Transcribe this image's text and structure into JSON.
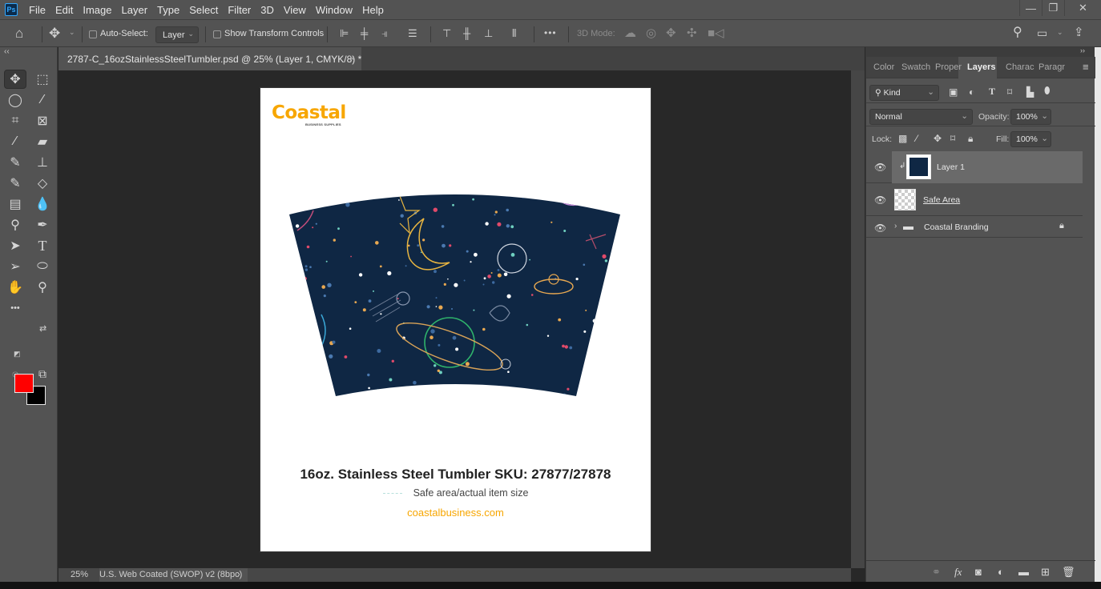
{
  "app": {
    "logo_text": "Ps"
  },
  "menu": [
    "File",
    "Edit",
    "Image",
    "Layer",
    "Type",
    "Select",
    "Filter",
    "3D",
    "View",
    "Window",
    "Help"
  ],
  "window_controls": {
    "minimize": "—",
    "restore": "❐",
    "close": "✕"
  },
  "options_bar": {
    "auto_select_label": "Auto-Select:",
    "auto_select_checked": false,
    "auto_select_target": "Layer",
    "show_transform_label": "Show Transform Controls",
    "show_transform_checked": false,
    "more_label": "•••",
    "three_d_mode_label": "3D Mode:"
  },
  "document": {
    "tab_title": "2787-C_16ozStainlessSteelTumbler.psd @ 25% (Layer 1, CMYK/8) *",
    "close_glyph": "×",
    "logo_main": "Coastal",
    "logo_sub": "BUSINESS SUPPLIES",
    "product_title": "16oz. Stainless Steel Tumbler SKU: 27877/27878",
    "legend_text": "Safe area/actual item size",
    "website": "coastalbusiness.com",
    "artwork_bg_color": "#0f2744",
    "brand_color": "#f7a600"
  },
  "status_bar": {
    "zoom": "25%",
    "profile": "U.S. Web Coated (SWOP) v2 (8bpc)",
    "arrow": "›"
  },
  "colors": {
    "foreground": "#ff0000",
    "background": "#000000"
  },
  "panel": {
    "tabs": [
      "Color",
      "Swatch",
      "Proper",
      "Layers",
      "Charac",
      "Paragr"
    ],
    "active_tab": "Layers",
    "filter_kind": "Kind",
    "blend_mode": "Normal",
    "opacity_label": "Opacity:",
    "opacity": "100%",
    "lock_label": "Lock:",
    "fill_label": "Fill:",
    "fill": "100%",
    "layers": [
      {
        "name": "Layer 1",
        "visible": true,
        "selected": true,
        "clipped": true,
        "type": "pixel"
      },
      {
        "name": "Safe Area",
        "visible": true,
        "selected": false,
        "type": "pixel"
      },
      {
        "name": "Coastal Branding",
        "visible": true,
        "selected": false,
        "type": "group",
        "locked": true
      }
    ]
  }
}
